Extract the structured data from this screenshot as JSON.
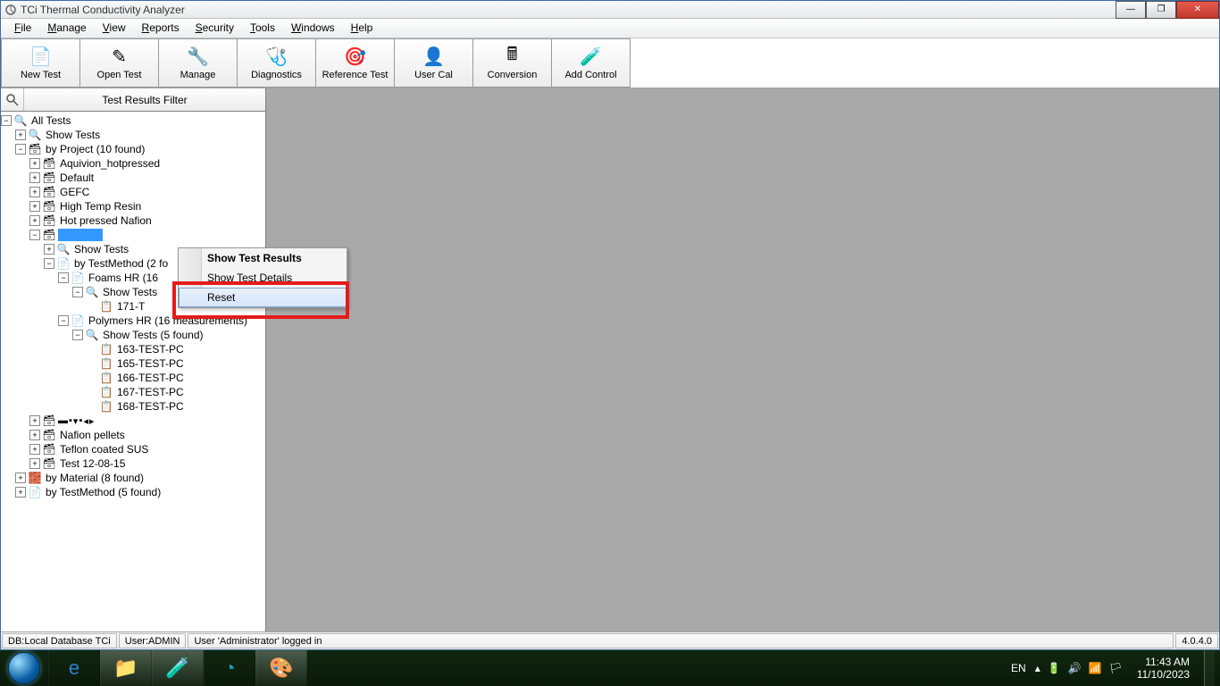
{
  "titlebar": {
    "title": "TCi Thermal Conductivity Analyzer"
  },
  "menubar": {
    "items": [
      {
        "label": "File",
        "key": "F"
      },
      {
        "label": "Manage",
        "key": "M"
      },
      {
        "label": "View",
        "key": "V"
      },
      {
        "label": "Reports",
        "key": "R"
      },
      {
        "label": "Security",
        "key": "S"
      },
      {
        "label": "Tools",
        "key": "T"
      },
      {
        "label": "Windows",
        "key": "W"
      },
      {
        "label": "Help",
        "key": "H"
      }
    ]
  },
  "toolbar": {
    "items": [
      {
        "label": "New Test"
      },
      {
        "label": "Open Test"
      },
      {
        "label": "Manage"
      },
      {
        "label": "Diagnostics"
      },
      {
        "label": "Reference Test"
      },
      {
        "label": "User Cal"
      },
      {
        "label": "Conversion"
      },
      {
        "label": "Add Control"
      }
    ]
  },
  "sidebar": {
    "filter_label": "Test Results Filter",
    "tree": {
      "all_tests": "All Tests",
      "show_tests": "Show Tests",
      "by_project": "by Project (10 found)",
      "projects": [
        "Aquivion_hotpressed",
        "Default",
        "GEFC",
        "High Temp Resin",
        "Hot pressed Nafion"
      ],
      "selected_project_placeholder": "",
      "sub_show_tests": "Show Tests",
      "sub_by_testmethod": "by TestMethod (2 fo",
      "foams": "Foams HR (16",
      "foams_show_tests": "Show Tests",
      "foams_test": "171-T",
      "polymers": "Polymers HR (16 measurements)",
      "polymers_show_tests": "Show Tests (5 found)",
      "polymers_tests": [
        "163-TEST-PC",
        "165-TEST-PC",
        "166-TEST-PC",
        "167-TEST-PC",
        "168-TEST-PC"
      ],
      "nafion_pellets": "Nafion pellets",
      "teflon_sus": "Teflon coated SUS",
      "test_1208": "Test 12-08-15",
      "by_material": "by Material (8 found)",
      "by_testmethod_bottom": "by TestMethod (5 found)"
    }
  },
  "context_menu": {
    "items": [
      "Show Test Results",
      "Show Test Details",
      "Reset"
    ]
  },
  "statusbar": {
    "db": "DB:Local Database TCi",
    "user": "User:ADMIN",
    "msg": "User 'Administrator' logged in",
    "version": "4.0.4.0"
  },
  "taskbar": {
    "lang": "EN",
    "time": "11:43 AM",
    "date": "11/10/2023"
  }
}
